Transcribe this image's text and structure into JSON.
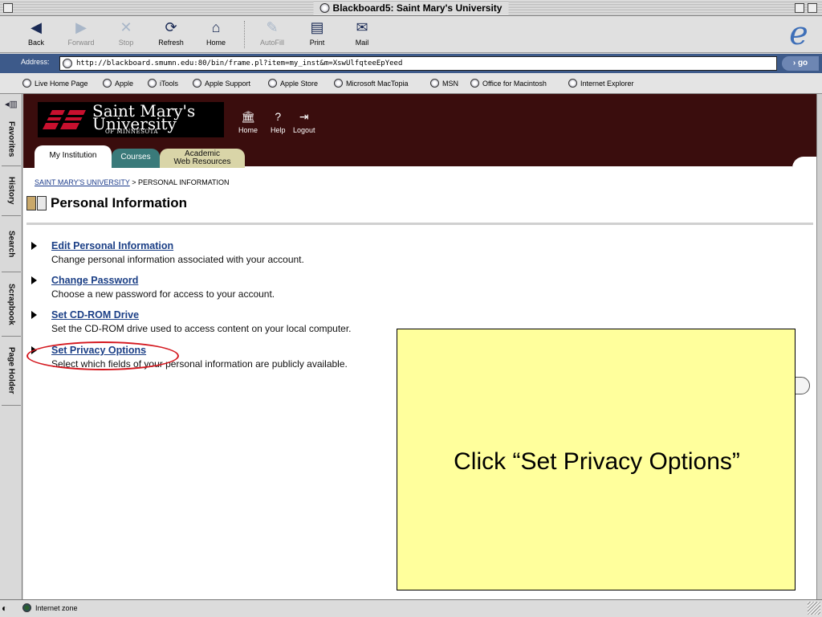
{
  "window": {
    "title": "Blackboard5: Saint Mary's University"
  },
  "toolbar": {
    "back": "Back",
    "forward": "Forward",
    "stop": "Stop",
    "refresh": "Refresh",
    "home": "Home",
    "autofill": "AutoFill",
    "print": "Print",
    "mail": "Mail"
  },
  "address": {
    "label": "Address:",
    "url": "http://blackboard.smumn.edu:80/bin/frame.pl?item=my_inst&m=XswUlfqteeEpYeed",
    "go": "go"
  },
  "favorites": [
    "Live Home Page",
    "Apple",
    "iTools",
    "Apple Support",
    "Apple Store",
    "Microsoft MacTopia",
    "MSN",
    "Office for Macintosh",
    "Internet Explorer"
  ],
  "sidebar": {
    "tabs": [
      "Favorites",
      "History",
      "Search",
      "Scrapbook",
      "Page Holder"
    ]
  },
  "site": {
    "logo": {
      "line1": "Saint Mary's",
      "line2": "University",
      "line3": "OF MINNESOTA"
    },
    "header_buttons": {
      "home": "Home",
      "help": "Help",
      "logout": "Logout"
    },
    "tabs": {
      "institution": "My Institution",
      "courses": "Courses",
      "resources_1": "Academic",
      "resources_2": "Web Resources"
    }
  },
  "breadcrumb": {
    "root": "SAINT MARY'S UNIVERSITY",
    "sep": " > ",
    "current": "PERSONAL INFORMATION"
  },
  "page": {
    "title": "Personal Information"
  },
  "options": [
    {
      "label": "Edit Personal Information",
      "desc": "Change personal information associated with your account."
    },
    {
      "label": "Change Password",
      "desc": "Choose a new password for access to your account."
    },
    {
      "label": "Set CD-ROM Drive",
      "desc": "Set the CD-ROM drive used to access content on your local computer."
    },
    {
      "label": "Set Privacy Options",
      "desc": "Select which fields of your personal information are publicly available."
    }
  ],
  "callout": {
    "text": "Click “Set Privacy Options”"
  },
  "status": {
    "zone": "Internet zone"
  },
  "colors": {
    "banner": "#3a0d0d",
    "link": "#1b3f86",
    "callout_bg": "#ffff9c",
    "highlight_ring": "#d4181f"
  }
}
